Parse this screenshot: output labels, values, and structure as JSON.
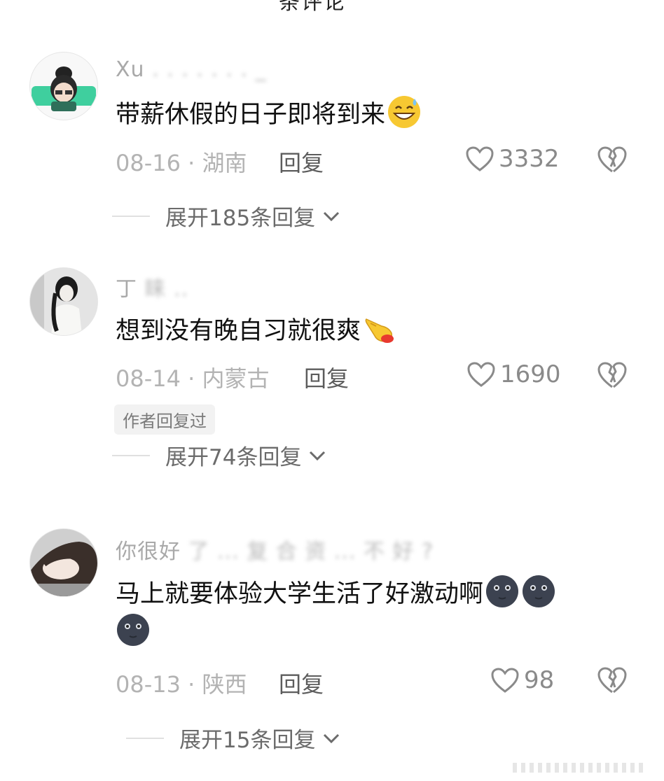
{
  "header": {
    "title_fragment": "条评论"
  },
  "comments": [
    {
      "username": "Xu",
      "text": "带薪休假的日子即将到来",
      "emoji": "grinning-sweat-emoji",
      "date_region": "08-16 · 湖南",
      "reply_label": "回复",
      "likes": "3332",
      "expand_label": "展开185条回复"
    },
    {
      "username": "丁",
      "text": "想到没有晚自习就很爽",
      "emoji": "pointing-hand-emoji",
      "date_region": "08-14 · 内蒙古",
      "reply_label": "回复",
      "likes": "1690",
      "author_badge": "作者回复过",
      "expand_label": "展开74条回复"
    },
    {
      "username": "你很好",
      "text": "马上就要体验大学生活了好激动啊",
      "emoji": "new-moon-face-emoji",
      "date_region": "08-13 · 陕西",
      "reply_label": "回复",
      "likes": "98",
      "expand_label": "展开15条回复"
    }
  ],
  "icons": {
    "like": "heart-outline-icon",
    "dislike": "broken-heart-icon",
    "expand": "chevron-down-icon"
  }
}
